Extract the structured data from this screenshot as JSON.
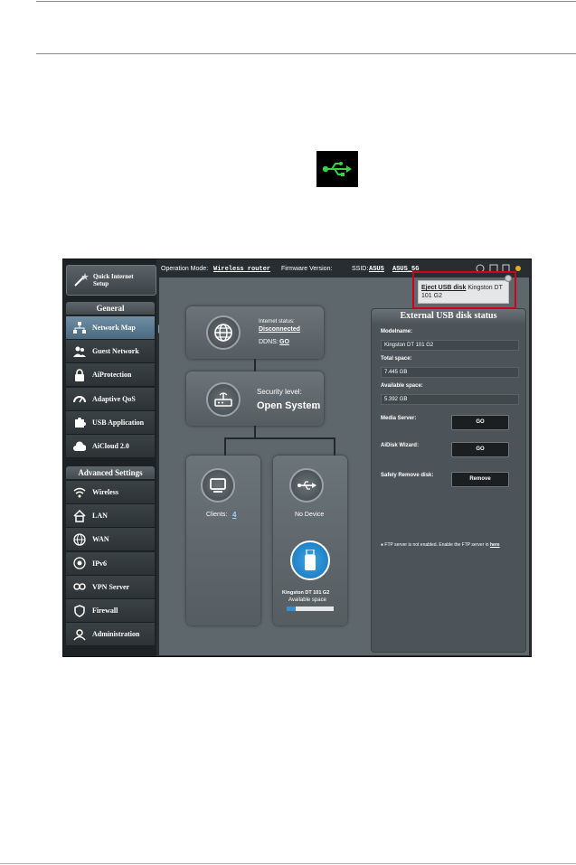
{
  "doc": {
    "rules": [
      "top",
      "middle",
      "bottom"
    ]
  },
  "usb_icon": {
    "name": "usb-icon",
    "color": "#3ad14a",
    "background": "#000000"
  },
  "router": {
    "topbar": {
      "operation_mode_label": "Operation Mode:",
      "operation_mode_value": "Wireless router",
      "firmware_label": "Firmware Version:",
      "ssid_label": "SSID:",
      "ssid_value": "ASUS",
      "ssid_value2": "ASUS_5G"
    },
    "sidebar": {
      "quick_setup": "Quick Internet\nSetup",
      "general_header": "General",
      "general_items": [
        {
          "label": "Network Map",
          "icon": "network-map-icon"
        },
        {
          "label": "Guest Network",
          "icon": "guest-network-icon"
        },
        {
          "label": "AiProtection",
          "icon": "lock-icon"
        },
        {
          "label": "Adaptive QoS",
          "icon": "gauge-icon"
        },
        {
          "label": "USB Application",
          "icon": "puzzle-icon"
        },
        {
          "label": "AiCloud 2.0",
          "icon": "cloud-icon"
        }
      ],
      "advanced_header": "Advanced Settings",
      "advanced_items": [
        {
          "label": "Wireless",
          "icon": "wifi-icon"
        },
        {
          "label": "LAN",
          "icon": "home-icon"
        },
        {
          "label": "WAN",
          "icon": "globe-icon"
        },
        {
          "label": "IPv6",
          "icon": "ipv6-icon"
        },
        {
          "label": "VPN Server",
          "icon": "vpn-icon"
        },
        {
          "label": "Firewall",
          "icon": "shield-icon"
        },
        {
          "label": "Administration",
          "icon": "user-icon"
        }
      ]
    },
    "network_map": {
      "internet_status_label": "Internet status:",
      "internet_status_value": "Disconnected",
      "ddns_label": "DDNS:",
      "ddns_value": "GO",
      "security_label": "Security level:",
      "security_value": "Open System",
      "clients_label": "Clients:",
      "clients_value": "4",
      "no_device": "No Device",
      "usb_device_name": "Kingston DT 101 G2",
      "available_space_label": "Available space",
      "available_space_fraction": 0.2
    },
    "external_usb": {
      "title": "External USB disk status",
      "model_label": "Modelname:",
      "model_value": "Kingston DT 101 G2",
      "total_label": "Total space:",
      "total_value": "7.445 GB",
      "available_label": "Available space:",
      "available_value": "5.392 GB",
      "media_server_label": "Media Server:",
      "aidisk_label": "AiDisk Wizard:",
      "safely_remove_label": "Safely Remove disk:",
      "go_label": "GO",
      "remove_label": "Remove",
      "ftp_note": "FTP server is not enabled. Enable the FTP server in",
      "ftp_link": "here"
    },
    "popup": {
      "eject_label": "Eject USB disk",
      "eject_device": "Kingston DT 101 G2",
      "highlight_color": "#d0021b"
    }
  }
}
